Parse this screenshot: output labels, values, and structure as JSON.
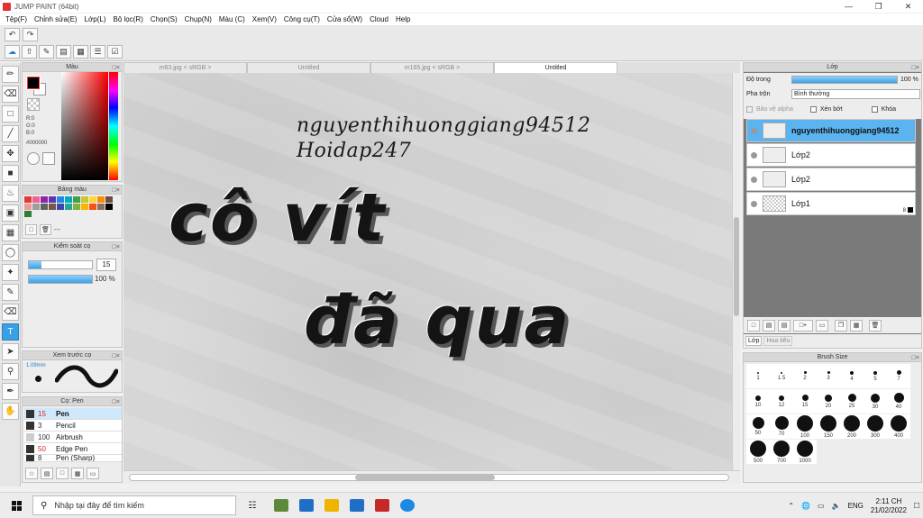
{
  "window": {
    "title": "JUMP PAINT (64bit)"
  },
  "menu": [
    "Tệp(F)",
    "Chỉnh sửa(E)",
    "Lớp(L)",
    "Bộ lọc(R)",
    "Chọn(S)",
    "Chụp(N)",
    "Màu (C)",
    "Xem(V)",
    "Công cụ(T)",
    "Cửa sổ(W)",
    "Cloud",
    "Help"
  ],
  "color_panel": {
    "title": "Màu",
    "r": "R:0",
    "g": "G:0",
    "b": "B:0",
    "hex": "#000000"
  },
  "swatch_panel": {
    "title": "Bảng màu",
    "dash": "---",
    "colors": [
      "#e53935",
      "#f06292",
      "#8e24aa",
      "#5e35b1",
      "#1e88e5",
      "#00acc1",
      "#43a047",
      "#c0ca33",
      "#fdd835",
      "#fb8c00",
      "#6d4c41",
      "#ef9a9a",
      "#9e9e9e",
      "#616161",
      "#795548",
      "#3949ab",
      "#26a69a",
      "#7cb342",
      "#ffb300",
      "#f4511e",
      "#8d6e63",
      "#000000",
      "#2e7d32"
    ]
  },
  "brush_control": {
    "title": "Kiểm soát cọ",
    "size_value": "15",
    "opacity_value": "100 %",
    "size_fraction": 0.2,
    "opacity_fraction": 1.0
  },
  "brush_preview": {
    "title": "Xem trước cọ",
    "size_label": "1.09mm"
  },
  "brush_list": {
    "title": "Cọ: Pen",
    "items": [
      {
        "size": "15",
        "name": "Pen",
        "red": true,
        "selected": true
      },
      {
        "size": "3",
        "name": "Pencil",
        "red": false,
        "selected": false
      },
      {
        "size": "100",
        "name": "Airbrush",
        "red": false,
        "selected": false
      },
      {
        "size": "50",
        "name": "Edge Pen",
        "red": true,
        "selected": false
      },
      {
        "size": "8",
        "name": "Pen (Sharp)",
        "red": false,
        "selected": false
      }
    ]
  },
  "doc_tabs": [
    "m63.jpg < sRGB >",
    "Untitled",
    "m165.jpg < sRGB >",
    "Untitled"
  ],
  "canvas": {
    "line1": "nguyenthihuonggiang94512",
    "line2": "Hoidap247",
    "big1": "cô vít",
    "big2": "đã qua"
  },
  "layers_panel": {
    "title": "Lớp",
    "opacity_label": "Độ trong",
    "opacity_value": "100 %",
    "blend_label": "Pha trộn",
    "blend_value": "Bình thường",
    "protect_alpha": "Bảo vệ alpha",
    "clipping": "Xén bớt",
    "lock": "Khóa",
    "layers": [
      {
        "name": "nguyenthihuonggiang94512",
        "selected": true
      },
      {
        "name": "Lớp2",
        "selected": false
      },
      {
        "name": "Lớp2",
        "selected": false
      },
      {
        "name": "Lớp1",
        "selected": false
      }
    ],
    "layer1_badge": "8",
    "tab_layer": "Lớp",
    "tab_template": "Hoa tiêu"
  },
  "brush_size_panel": {
    "title": "Brush Size",
    "sizes": [
      "1",
      "1.5",
      "2",
      "3",
      "4",
      "5",
      "7",
      "10",
      "12",
      "15",
      "20",
      "25",
      "30",
      "40",
      "50",
      "70",
      "100",
      "150",
      "200",
      "300",
      "400",
      "500",
      "700",
      "1000"
    ]
  },
  "taskbar": {
    "search_placeholder": "Nhập tại đây để tìm kiếm",
    "lang": "ENG",
    "time": "2:11 CH",
    "date": "21/02/2022",
    "apps": [
      "#5c8a3a",
      "#1f6fc7",
      "#f0b400",
      "#1f6fc7",
      "#c62828",
      "#1e88e5"
    ]
  }
}
